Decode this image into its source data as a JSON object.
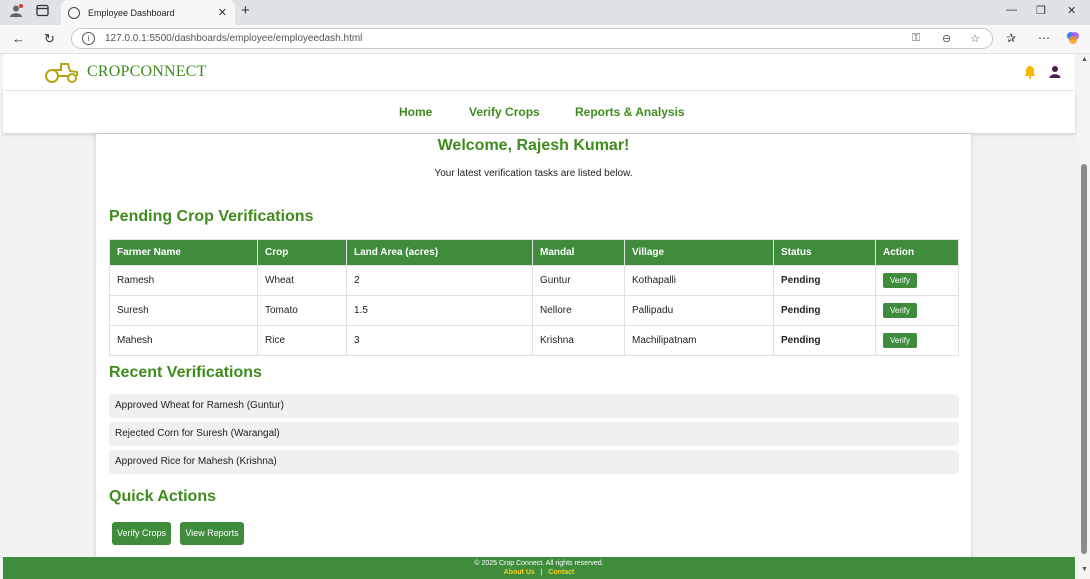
{
  "browser": {
    "tab_title": "Employee Dashboard",
    "url": "127.0.0.1:5500/dashboards/employee/employeedash.html"
  },
  "site": {
    "brand": "CROPCONNECT",
    "nav": [
      "Home",
      "Verify Crops",
      "Reports & Analysis"
    ]
  },
  "welcome": {
    "heading": "Welcome, Rajesh Kumar!",
    "subtitle": "Your latest verification tasks are listed below."
  },
  "pending": {
    "heading": "Pending Crop Verifications",
    "columns": [
      "Farmer Name",
      "Crop",
      "Land Area (acres)",
      "Mandal",
      "Village",
      "Status",
      "Action"
    ],
    "rows": [
      {
        "farmer": "Ramesh",
        "crop": "Wheat",
        "area": "2",
        "mandal": "Guntur",
        "village": "Kothapalli",
        "status": "Pending",
        "action": "Verify"
      },
      {
        "farmer": "Suresh",
        "crop": "Tomato",
        "area": "1.5",
        "mandal": "Nellore",
        "village": "Pallipadu",
        "status": "Pending",
        "action": "Verify"
      },
      {
        "farmer": "Mahesh",
        "crop": "Rice",
        "area": "3",
        "mandal": "Krishna",
        "village": "Machilipatnam",
        "status": "Pending",
        "action": "Verify"
      }
    ]
  },
  "recent": {
    "heading": "Recent Verifications",
    "items": [
      "Approved Wheat for Ramesh (Guntur)",
      "Rejected Corn for Suresh (Warangal)",
      "Approved Rice for Mahesh (Krishna)"
    ]
  },
  "quick_actions": {
    "heading": "Quick Actions",
    "buttons": [
      "Verify Crops",
      "View Reports"
    ]
  },
  "footer": {
    "copyright": "© 2025 Crop Connect. All rights reserved.",
    "links": [
      "About Us",
      "Contact"
    ],
    "separator": "|"
  },
  "colors": {
    "brand_green": "#3f8c3c",
    "pending_orange": "#f39c12",
    "footer_link": "#f7d31c"
  },
  "icons": [
    "profile-icon",
    "tab-actions-icon",
    "globe-icon",
    "close-icon",
    "new-tab-icon",
    "back-icon",
    "reload-icon",
    "info-icon",
    "key-icon",
    "zoom-icon",
    "favorite-star-icon",
    "favorites-icon",
    "menu-icon",
    "copilot-icon",
    "tractor-logo-icon",
    "bell-icon",
    "user-icon"
  ]
}
